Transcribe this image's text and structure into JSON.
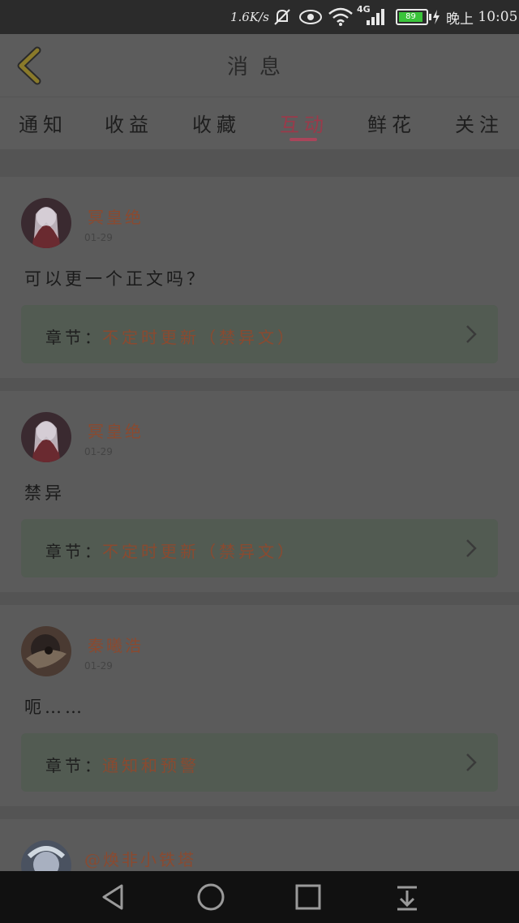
{
  "status_bar": {
    "speed": "1.6K/s",
    "network": "4G",
    "battery": "89",
    "time_prefix": "晚上",
    "time": "10:05",
    "icons": [
      "mute-icon",
      "eye-icon",
      "wifi-icon",
      "signal-icon",
      "battery-icon",
      "charging-icon"
    ]
  },
  "header": {
    "title": "消息",
    "back_icon": "chevron-left-icon"
  },
  "tabs": [
    {
      "label": "通知",
      "active": false
    },
    {
      "label": "收益",
      "active": false
    },
    {
      "label": "收藏",
      "active": false
    },
    {
      "label": "互动",
      "active": true
    },
    {
      "label": "鲜花",
      "active": false
    },
    {
      "label": "关注",
      "active": false
    }
  ],
  "messages": [
    {
      "user": "冥皇绝",
      "date": "01-29",
      "comment": "可以更一个正文吗？",
      "chapter_label": "章节：",
      "chapter_title": "不定时更新（禁异文）"
    },
    {
      "user": "冥皇绝",
      "date": "01-29",
      "comment": "禁异",
      "chapter_label": "章节：",
      "chapter_title": "不定时更新（禁异文）"
    },
    {
      "user": "秦曦浩",
      "date": "01-29",
      "comment": "呃……",
      "chapter_label": "章节：",
      "chapter_title": "通知和预警"
    },
    {
      "user": "@焕非小铁塔"
    }
  ],
  "nav_bar": {
    "icons": [
      "back-triangle-icon",
      "home-circle-icon",
      "recent-square-icon",
      "notification-pull-icon"
    ]
  },
  "colors": {
    "accent": "#a8455a",
    "username": "#8a4a30"
  }
}
